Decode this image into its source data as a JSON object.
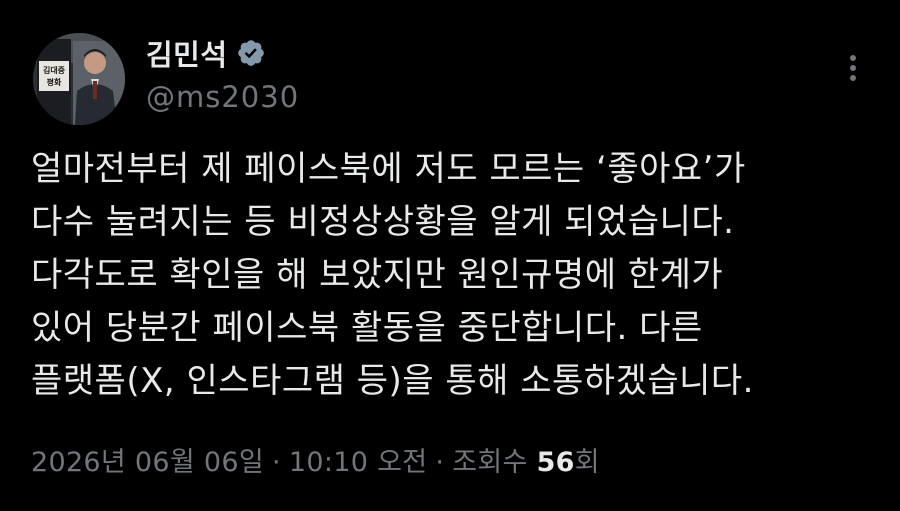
{
  "author": {
    "display_name": "김민석",
    "handle": "@ms2030",
    "verified": true,
    "avatar_sign_text": [
      "김대중",
      "평화"
    ]
  },
  "tweet": {
    "lines": [
      "얼마전부터 제 페이스북에 저도 모르는 ‘좋아요’가",
      "다수 눌려지는 등 비정상상황을 알게 되었습니다.",
      "다각도로 확인을 해 보았지만 원인규명에 한계가",
      "있어 당분간 페이스북 활동을 중단합니다. 다른",
      "플랫폼(X, 인스타그램 등)을 통해 소통하겠습니다."
    ]
  },
  "meta": {
    "date": "2026년 06월 06일",
    "separator": "·",
    "time": "10:10 오전",
    "views_label": "조회수",
    "views_count": "56",
    "views_suffix": "회"
  },
  "colors": {
    "background": "#000000",
    "text_primary": "#e7e9ea",
    "text_secondary": "#71767b",
    "verified_badge": "#829aab"
  },
  "icons": {
    "verified": "verified-badge-icon",
    "more": "more-options-icon"
  }
}
